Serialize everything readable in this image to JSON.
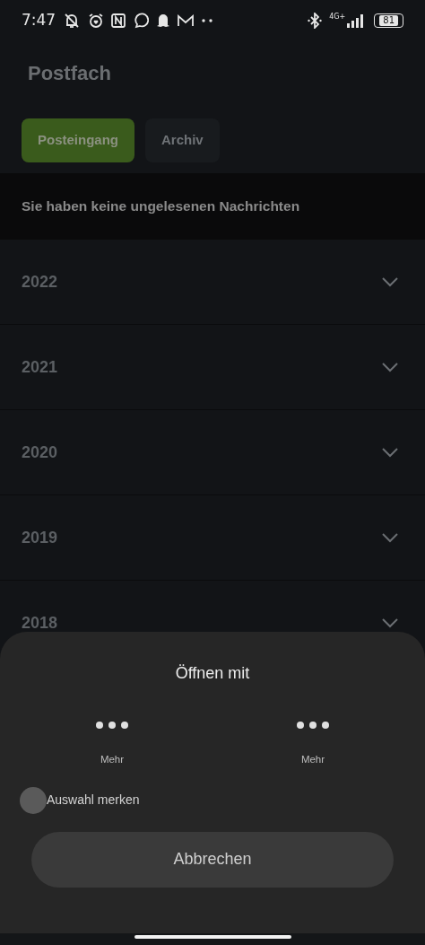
{
  "status_bar": {
    "time": "7:47",
    "network": "4G+",
    "battery": "81"
  },
  "header": {
    "title": "Postfach"
  },
  "tabs": [
    {
      "label": "Posteingang",
      "selected": true
    },
    {
      "label": "Archiv",
      "selected": false
    }
  ],
  "banner": {
    "text": "Sie haben keine ungelesenen Nachrichten"
  },
  "years": [
    {
      "label": "2022",
      "expanded": false
    },
    {
      "label": "2021",
      "expanded": false
    },
    {
      "label": "2020",
      "expanded": false
    },
    {
      "label": "2019",
      "expanded": false
    },
    {
      "label": "2018",
      "expanded": false
    }
  ],
  "sheet": {
    "title": "Öffnen mit",
    "apps": [
      {
        "label": "Mehr"
      },
      {
        "label": "Mehr"
      }
    ],
    "remember": {
      "label": "Auswahl merken",
      "checked": false
    },
    "cancel": "Abbrechen"
  }
}
